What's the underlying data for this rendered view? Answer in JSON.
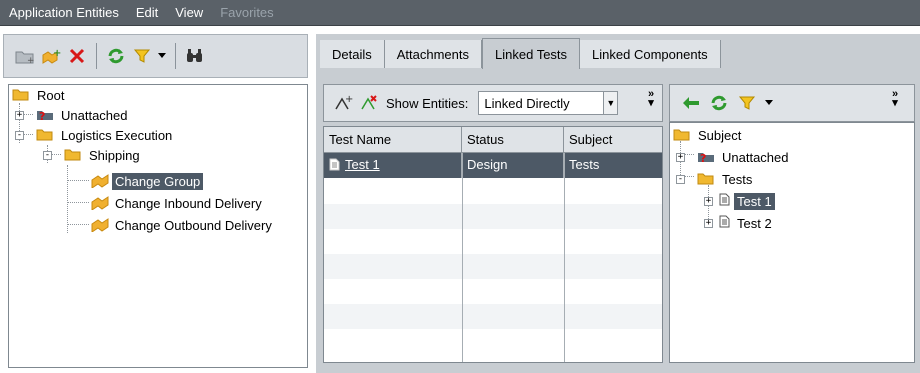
{
  "menubar": {
    "items": [
      {
        "label": "Application Entities",
        "disabled": false
      },
      {
        "label": "Edit",
        "disabled": false
      },
      {
        "label": "View",
        "disabled": false
      },
      {
        "label": "Favorites",
        "disabled": true
      }
    ]
  },
  "left_toolbar": {
    "icons": [
      "new-folder-icon",
      "new-entity-icon",
      "delete-icon",
      "refresh-icon",
      "filter-icon",
      "find-icon"
    ]
  },
  "left_tree": {
    "root": "Root",
    "unattached": "Unattached",
    "logistics": "Logistics Execution",
    "shipping": "Shipping",
    "change_group": "Change Group",
    "change_inbound": "Change Inbound Delivery",
    "change_outbound": "Change Outbound Delivery",
    "selected": "Change Group"
  },
  "tabs": [
    {
      "label": "Details",
      "active": false
    },
    {
      "label": "Attachments",
      "active": false
    },
    {
      "label": "Linked Tests",
      "active": true
    },
    {
      "label": "Linked Components",
      "active": false
    }
  ],
  "mid_toolbar": {
    "show_entities_label": "Show Entities:",
    "show_entities_value": "Linked Directly"
  },
  "grid": {
    "columns": [
      "Test Name",
      "Status",
      "Subject"
    ],
    "rows": [
      {
        "name": "Test 1",
        "status": "Design",
        "subject": "Tests",
        "selected": true
      }
    ]
  },
  "right_tree": {
    "subject": "Subject",
    "unattached": "Unattached",
    "tests": "Tests",
    "test1": "Test 1",
    "test2": "Test 2",
    "selected": "Test 1"
  },
  "colors": {
    "menubar_bg": "#5a6168",
    "selection": "#4d5966",
    "panel_bg": "#c8cdd2",
    "link": "#0000cc"
  }
}
